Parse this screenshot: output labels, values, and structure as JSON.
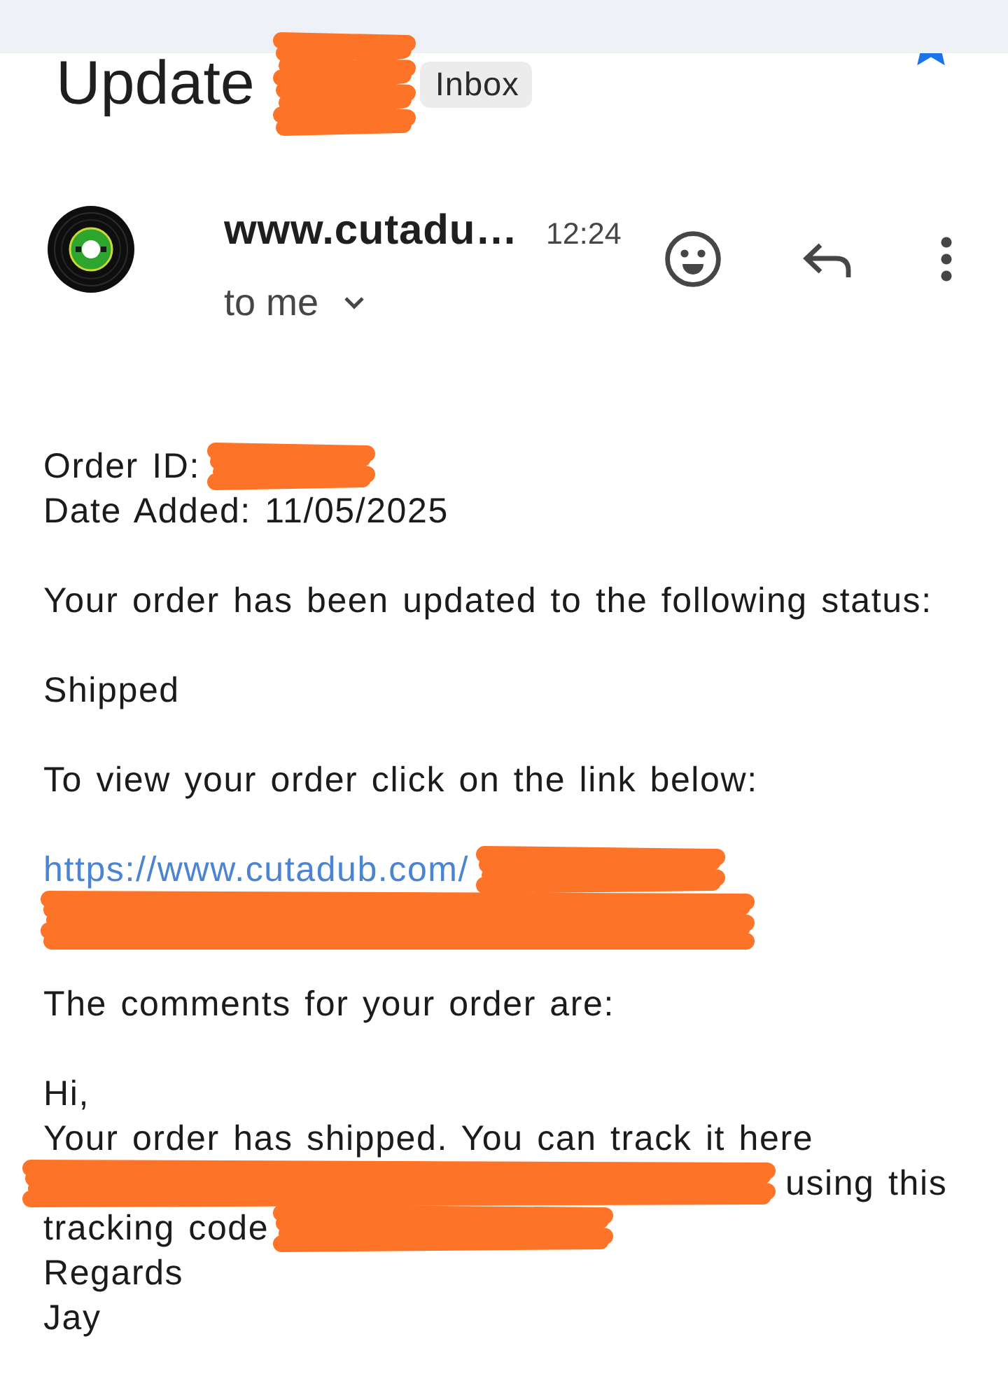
{
  "subject": {
    "parts": [
      {
        "kind": "text",
        "text": "Update"
      },
      {
        "kind": "redacted"
      }
    ],
    "label": "Inbox"
  },
  "message": {
    "sender": "www.cutadu…",
    "time": "12:24",
    "recipient": "to me"
  },
  "body": [
    [
      [
        {
          "kind": "text",
          "text": "Order ID:"
        },
        {
          "kind": "redacted"
        }
      ],
      [
        {
          "kind": "text",
          "text": "Date Added: 11/05/2025"
        }
      ]
    ],
    [
      [
        {
          "kind": "text",
          "text": "Your order has been updated to the following status:"
        }
      ]
    ],
    [
      [
        {
          "kind": "text",
          "text": "Shipped"
        }
      ]
    ],
    [
      [
        {
          "kind": "text",
          "text": "To view your order click on the link below:"
        }
      ]
    ],
    [
      [
        {
          "kind": "link",
          "text": "https://www.cutadub.com/"
        },
        {
          "kind": "redacted"
        }
      ],
      [
        {
          "kind": "redacted"
        }
      ]
    ],
    [
      [
        {
          "kind": "text",
          "text": "The comments for your order are:"
        }
      ]
    ],
    [
      [
        {
          "kind": "text",
          "text": "Hi,"
        }
      ],
      [
        {
          "kind": "text",
          "text": "Your order has shipped. You can track it here"
        }
      ],
      [
        {
          "kind": "redacted"
        },
        {
          "kind": "text",
          "text": "using this"
        }
      ],
      [
        {
          "kind": "text",
          "text": "tracking code"
        },
        {
          "kind": "redacted"
        }
      ],
      [
        {
          "kind": "text",
          "text": "Regards"
        }
      ],
      [
        {
          "kind": "text",
          "text": "Jay"
        }
      ]
    ]
  ]
}
